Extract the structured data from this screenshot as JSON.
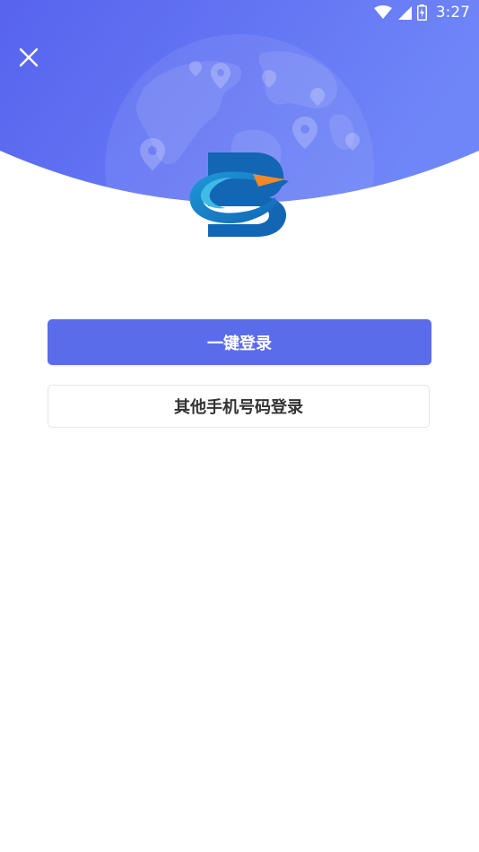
{
  "status_bar": {
    "time": "3:27",
    "icons": [
      "wifi-icon",
      "cell-signal-icon",
      "battery-icon"
    ]
  },
  "header": {
    "gradient_start": "#5a66ef",
    "gradient_end": "#6f86f7",
    "close_icon": "close-icon",
    "background_image": "globe-with-location-pins"
  },
  "logo": {
    "icon": "app-logo-letter-d-with-arrow",
    "colors": [
      "#1266b4",
      "#1e9ad7",
      "#f0892a"
    ]
  },
  "actions": {
    "one_click_login": "一键登录",
    "other_phone_login": "其他手机号码登录"
  },
  "colors": {
    "primary_button": "#5b6cea",
    "secondary_border": "#e6e6e6",
    "secondary_text": "#333333"
  }
}
